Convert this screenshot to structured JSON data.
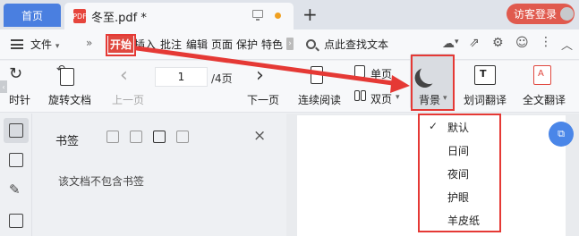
{
  "tabs": {
    "home_label": "首页",
    "doc_title": "冬至.pdf *",
    "pdf_icon_text": "PDF",
    "add_icon": "+",
    "login_label": "访客登录"
  },
  "menubar": {
    "file_label": "文件",
    "more_icon": "»",
    "items": [
      "开始",
      "插入",
      "批注",
      "编辑",
      "页面",
      "保护",
      "特色"
    ],
    "active_item": "开始",
    "search_label": "点此查找文本",
    "right_icons": [
      "cloud-icon",
      "share-icon",
      "settings-icon",
      "comment-icon",
      "more-icon",
      "collapse-icon"
    ]
  },
  "toolbar": {
    "rotate_partial_label": "时针",
    "rotate_doc_label": "旋转文档",
    "prev_page_label": "上一页",
    "current_page": "1",
    "page_total": "/4页",
    "next_page_label": "下一页",
    "continuous_label": "连续阅读",
    "single_page_label": "单页",
    "double_page_label": "双页",
    "background_label": "背景",
    "word_translate_label": "划词翻译",
    "full_translate_label": "全文翻译"
  },
  "bookmark_panel": {
    "title": "书签",
    "empty_text": "该文档不包含书签",
    "close_icon": "×"
  },
  "background_menu": {
    "items": [
      "默认",
      "日间",
      "夜间",
      "护眼",
      "羊皮纸"
    ],
    "selected": "默认",
    "check_mark": "✓"
  },
  "annotation": {
    "color": "#e53935"
  }
}
